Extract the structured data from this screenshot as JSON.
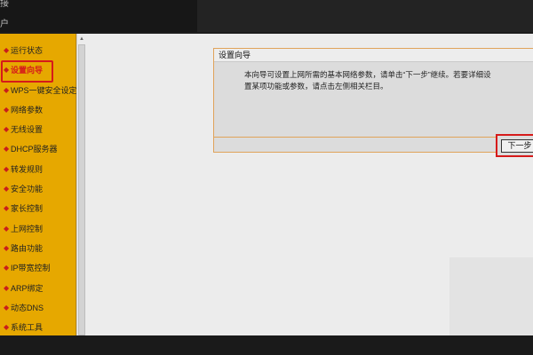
{
  "topbar": {
    "partial_text_1": "接",
    "partial_text_2": "户"
  },
  "sidebar": {
    "items": [
      {
        "label": "运行状态"
      },
      {
        "label": "设置向导"
      },
      {
        "label": "WPS一键安全设定"
      },
      {
        "label": "网络参数"
      },
      {
        "label": "无线设置"
      },
      {
        "label": "DHCP服务器"
      },
      {
        "label": "转发规则"
      },
      {
        "label": "安全功能"
      },
      {
        "label": "家长控制"
      },
      {
        "label": "上网控制"
      },
      {
        "label": "路由功能"
      },
      {
        "label": "IP带宽控制"
      },
      {
        "label": "ARP绑定"
      },
      {
        "label": "动态DNS"
      },
      {
        "label": "系统工具"
      }
    ],
    "bullet": "◆"
  },
  "scrollbar": {
    "up_arrow": "▲"
  },
  "panel": {
    "title": "设置向导",
    "line1": "本向导可设置上网所需的基本网络参数，请单击“下一步”继续。若要详细设",
    "line2": "置某项功能或参数，请点击左侧相关栏目。"
  },
  "buttons": {
    "next_label": "下一步"
  },
  "colors": {
    "sidebar_bg": "#e6a800",
    "highlight_red": "#d61a1a",
    "panel_border": "#e0a35a"
  }
}
